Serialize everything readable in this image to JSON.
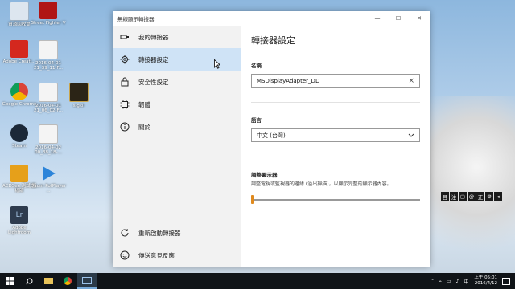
{
  "window": {
    "title": "無線顯示轉接器",
    "controls": {
      "minimize": "—",
      "maximize": "☐",
      "close": "✕"
    }
  },
  "sidebar": {
    "items": [
      {
        "label": "我的轉接器",
        "icon": "adapter-icon"
      },
      {
        "label": "轉接器設定",
        "icon": "gear-icon"
      },
      {
        "label": "安全性設定",
        "icon": "lock-icon"
      },
      {
        "label": "韌體",
        "icon": "chip-icon"
      },
      {
        "label": "關於",
        "icon": "info-icon"
      }
    ],
    "bottom_items": [
      {
        "label": "重新啟動轉接器",
        "icon": "restart-icon"
      },
      {
        "label": "傳送意見反應",
        "icon": "feedback-icon"
      }
    ]
  },
  "main": {
    "title": "轉接器設定",
    "name_label": "名稱",
    "name_value": "MSDisplayAdapter_DD",
    "clear_glyph": "×",
    "language_label": "語言",
    "language_value": "中文 (台灣)",
    "display_label": "調整顯示器",
    "display_desc": "調整電視或監視器的邊緣 (溢出掃描)，以顯示完整的顯示器內容。",
    "overscan_level": 0
  },
  "desktop_icons": [
    {
      "label": "資源回收筒"
    },
    {
      "label": "Street Fighter V"
    },
    {
      "label": "Adobe Creati..."
    },
    {
      "label": "2016-04-01 21_39_11-F..."
    },
    {
      "label": "Google Chrome"
    },
    {
      "label": "2016-04-01 21_06_02-F..."
    },
    {
      "label": "sigkil"
    },
    {
      "label": "Steam"
    },
    {
      "label": "2016-04-02 00_38_18-..."
    },
    {
      "label": "ACDSee 測試 圖檔版"
    },
    {
      "label": "Daum PotPlayer ..."
    },
    {
      "label": "Adobe Lightroom"
    }
  ],
  "ime_bar": [
    "目",
    "注",
    "▢",
    "@",
    "正",
    "⚙",
    "◂"
  ],
  "taskbar": {
    "time": "上午 05:01",
    "date": "2016/4/12",
    "tray_icons": [
      "^",
      "⌁",
      "▭",
      "♪",
      "中"
    ]
  }
}
